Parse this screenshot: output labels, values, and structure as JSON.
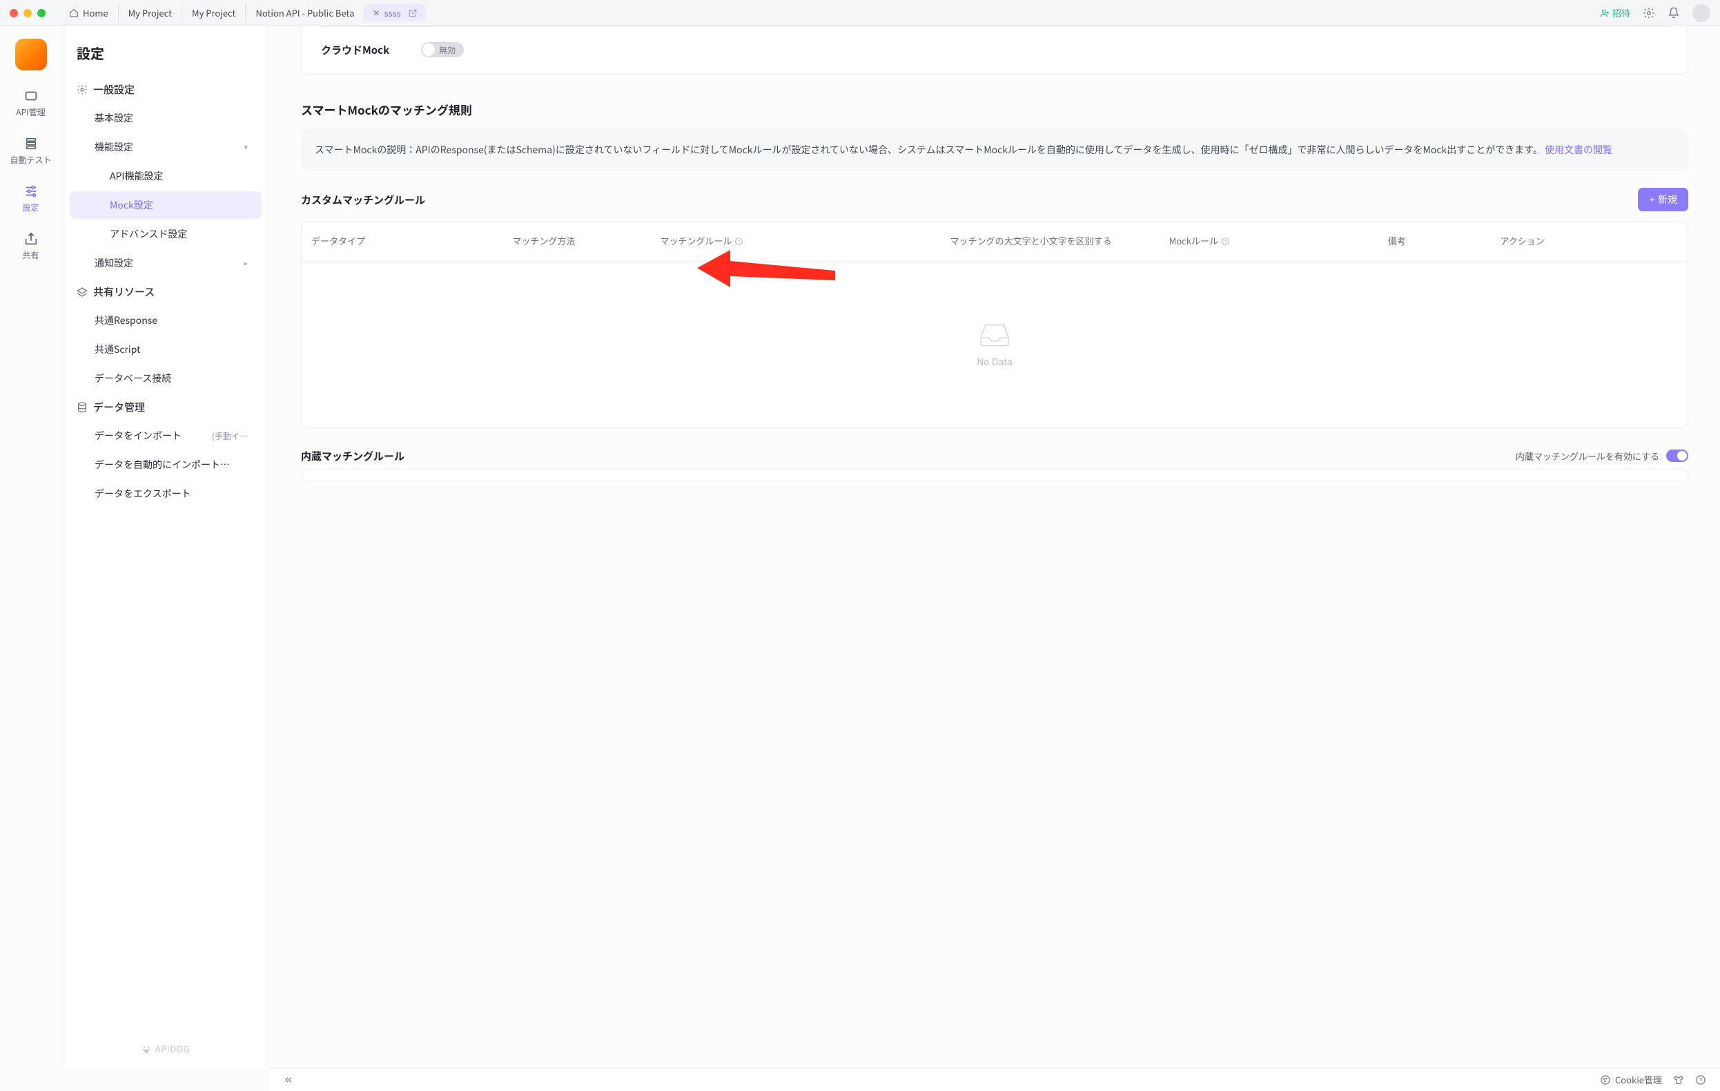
{
  "tabs": {
    "home": "Home",
    "project1": "My Project",
    "project2": "My Project",
    "notion": "Notion API - Public Beta",
    "sel": "ssss"
  },
  "topbar": {
    "invite": "招待"
  },
  "rail": {
    "api": "API管理",
    "test": "自動テスト",
    "settings": "設定",
    "share": "共有"
  },
  "side": {
    "title": "設定",
    "general": "一般設定",
    "basic": "基本設定",
    "func": "機能設定",
    "apiFunc": "API機能設定",
    "mock": "Mock設定",
    "advanced": "アドバンスド設定",
    "notify": "通知設定",
    "shared": "共有リソース",
    "commonResp": "共通Response",
    "commonScript": "共通Script",
    "dbConn": "データベース接続",
    "data": "データ管理",
    "import": "データをインポート",
    "importSub": "(手動イ…",
    "autoImport": "データを自動的にインポート…",
    "export": "データをエクスポート",
    "brand": "APIDOG"
  },
  "main": {
    "cloudMock": "クラウドMock",
    "cloudMockState": "無効",
    "smartTitle": "スマートMockのマッチング規則",
    "smartDesc1": "スマートMockの説明：APIのResponse(またはSchema)に設定されていないフィールドに対してMockルールが設定されていない場合、システムはスマートMockルールを自動的に使用してデータを生成し、使用時に「ゼロ構成」で非常に人間らしいデータをMock出すことができます。",
    "smartLink": "使用文書の閲覧",
    "customTitle": "カスタムマッチングルール",
    "newBtn": "新規",
    "cols": {
      "c1": "データタイプ",
      "c2": "マッチング方法",
      "c3": "マッチングルール",
      "c4": "マッチングの大文字と小文字を区別する",
      "c5": "Mockルール",
      "c6": "備考",
      "c7": "アクション"
    },
    "noData": "No Data",
    "builtinTitle": "内蔵マッチングルール",
    "builtinEnable": "内蔵マッチングルールを有効にする"
  },
  "footer": {
    "cookie": "Cookie管理"
  }
}
